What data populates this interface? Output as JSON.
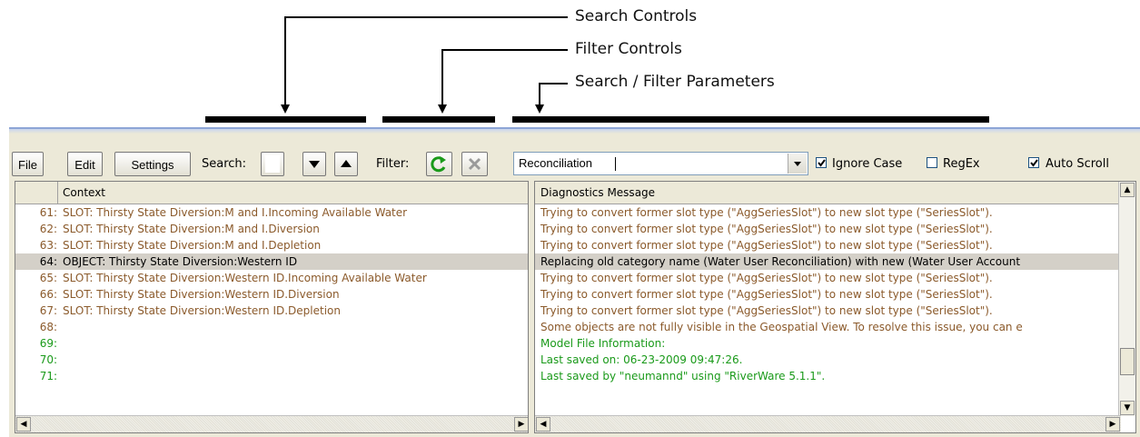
{
  "callouts": {
    "search_controls": "Search Controls",
    "filter_controls": "Filter Controls",
    "search_filter_parameters": "Search / Filter Parameters"
  },
  "toolbar": {
    "file": "File",
    "edit": "Edit",
    "settings": "Settings",
    "search_label": "Search:",
    "filter_label": "Filter:",
    "filter_value": "Reconciliation",
    "ignore_case_label": "Ignore Case",
    "ignore_case_checked": true,
    "regex_label": "RegEx",
    "regex_checked": false,
    "auto_scroll_label": "Auto Scroll",
    "auto_scroll_checked": true
  },
  "left_panel": {
    "header": "Context",
    "rows": [
      {
        "num": "61:",
        "text": "SLOT: Thirsty State Diversion:M and I.Incoming Available Water",
        "color": "brown"
      },
      {
        "num": "62:",
        "text": "SLOT: Thirsty State Diversion:M and I.Diversion",
        "color": "brown"
      },
      {
        "num": "63:",
        "text": "SLOT: Thirsty State Diversion:M and I.Depletion",
        "color": "brown"
      },
      {
        "num": "64:",
        "text": "OBJECT: Thirsty State Diversion:Western ID",
        "color": "black",
        "selected": true
      },
      {
        "num": "65:",
        "text": "SLOT: Thirsty State Diversion:Western ID.Incoming Available Water",
        "color": "brown"
      },
      {
        "num": "66:",
        "text": "SLOT: Thirsty State Diversion:Western ID.Diversion",
        "color": "brown"
      },
      {
        "num": "67:",
        "text": "SLOT: Thirsty State Diversion:Western ID.Depletion",
        "color": "brown"
      },
      {
        "num": "68:",
        "text": "",
        "color": "brown"
      },
      {
        "num": "69:",
        "text": "",
        "color": "green"
      },
      {
        "num": "70:",
        "text": "",
        "color": "green"
      },
      {
        "num": "71:",
        "text": "",
        "color": "green"
      }
    ]
  },
  "right_panel": {
    "header": "Diagnostics Message",
    "rows": [
      {
        "text": "Trying to convert former slot type (\"AggSeriesSlot\") to new slot type (\"SeriesSlot\").",
        "color": "brown"
      },
      {
        "text": "Trying to convert former slot type (\"AggSeriesSlot\") to new slot type (\"SeriesSlot\").",
        "color": "brown"
      },
      {
        "text": "Trying to convert former slot type (\"AggSeriesSlot\") to new slot type (\"SeriesSlot\").",
        "color": "brown"
      },
      {
        "text": "Replacing old category name (Water User Reconciliation) with new (Water User Account",
        "color": "black",
        "selected": true
      },
      {
        "text": "Trying to convert former slot type (\"AggSeriesSlot\") to new slot type (\"SeriesSlot\").",
        "color": "brown"
      },
      {
        "text": "Trying to convert former slot type (\"AggSeriesSlot\") to new slot type (\"SeriesSlot\").",
        "color": "brown"
      },
      {
        "text": "Trying to convert former slot type (\"AggSeriesSlot\") to new slot type (\"SeriesSlot\").",
        "color": "brown"
      },
      {
        "text": "Some objects are not fully visible in the Geospatial View. To resolve this issue, you can e",
        "color": "brown"
      },
      {
        "text": "Model File Information:",
        "color": "green"
      },
      {
        "text": "Last saved on: 06-23-2009 09:47:26.",
        "color": "green"
      },
      {
        "text": "Last saved by \"neumannd\" using \"RiverWare 5.1.1\".",
        "color": "green"
      }
    ]
  },
  "icons": {
    "search_box": "blank-search-icon",
    "search_next": "triangle-down-icon",
    "search_prev": "triangle-up-icon",
    "filter_apply": "refresh-icon",
    "filter_clear": "clear-x-icon",
    "combo": "dropdown-arrow-icon"
  },
  "colors": {
    "brown": "#8b5a2b",
    "green": "#1a9a1a",
    "selected_row": "#d4d0c8",
    "window_bg": "#ece9d8"
  }
}
